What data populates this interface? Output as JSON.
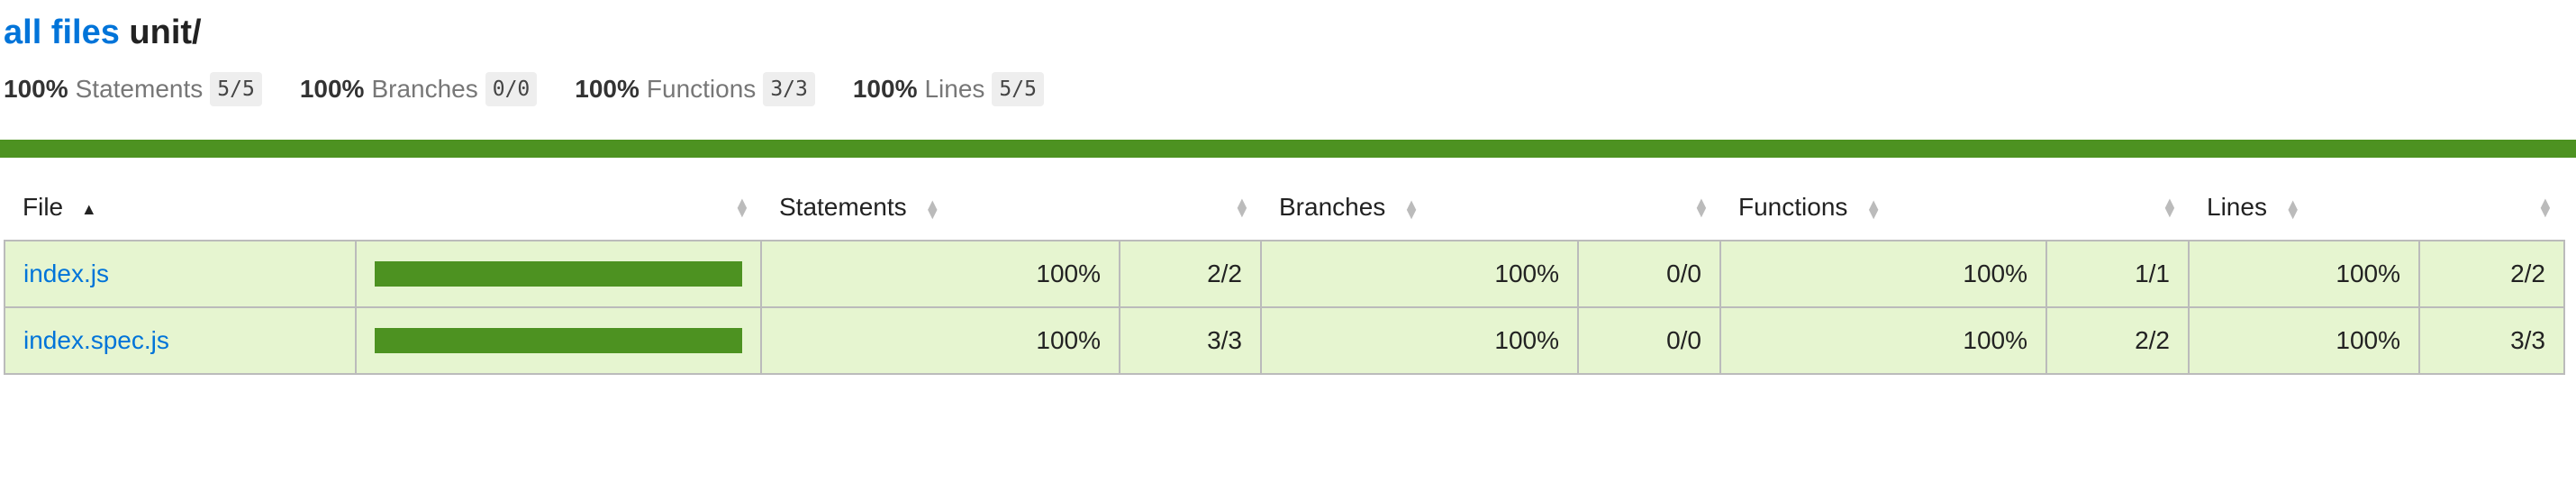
{
  "header": {
    "breadcrumb_link": "all files",
    "directory": "unit/"
  },
  "summary": [
    {
      "pct": "100%",
      "label": "Statements",
      "fraction": "5/5"
    },
    {
      "pct": "100%",
      "label": "Branches",
      "fraction": "0/0"
    },
    {
      "pct": "100%",
      "label": "Functions",
      "fraction": "3/3"
    },
    {
      "pct": "100%",
      "label": "Lines",
      "fraction": "5/5"
    }
  ],
  "colors": {
    "high_coverage": "#4d9221",
    "row_background": "#e6f5d0",
    "link": "#0074d9"
  },
  "table": {
    "columns": [
      "File",
      "Statements",
      "Branches",
      "Functions",
      "Lines"
    ],
    "sorted_by": "File",
    "sort_direction": "ascending",
    "rows": [
      {
        "file": "index.js",
        "coverage": 1.0,
        "statements_pct": "100%",
        "statements": "2/2",
        "branches_pct": "100%",
        "branches": "0/0",
        "functions_pct": "100%",
        "functions": "1/1",
        "lines_pct": "100%",
        "lines": "2/2"
      },
      {
        "file": "index.spec.js",
        "coverage": 1.0,
        "statements_pct": "100%",
        "statements": "3/3",
        "branches_pct": "100%",
        "branches": "0/0",
        "functions_pct": "100%",
        "functions": "2/2",
        "lines_pct": "100%",
        "lines": "3/3"
      }
    ]
  }
}
